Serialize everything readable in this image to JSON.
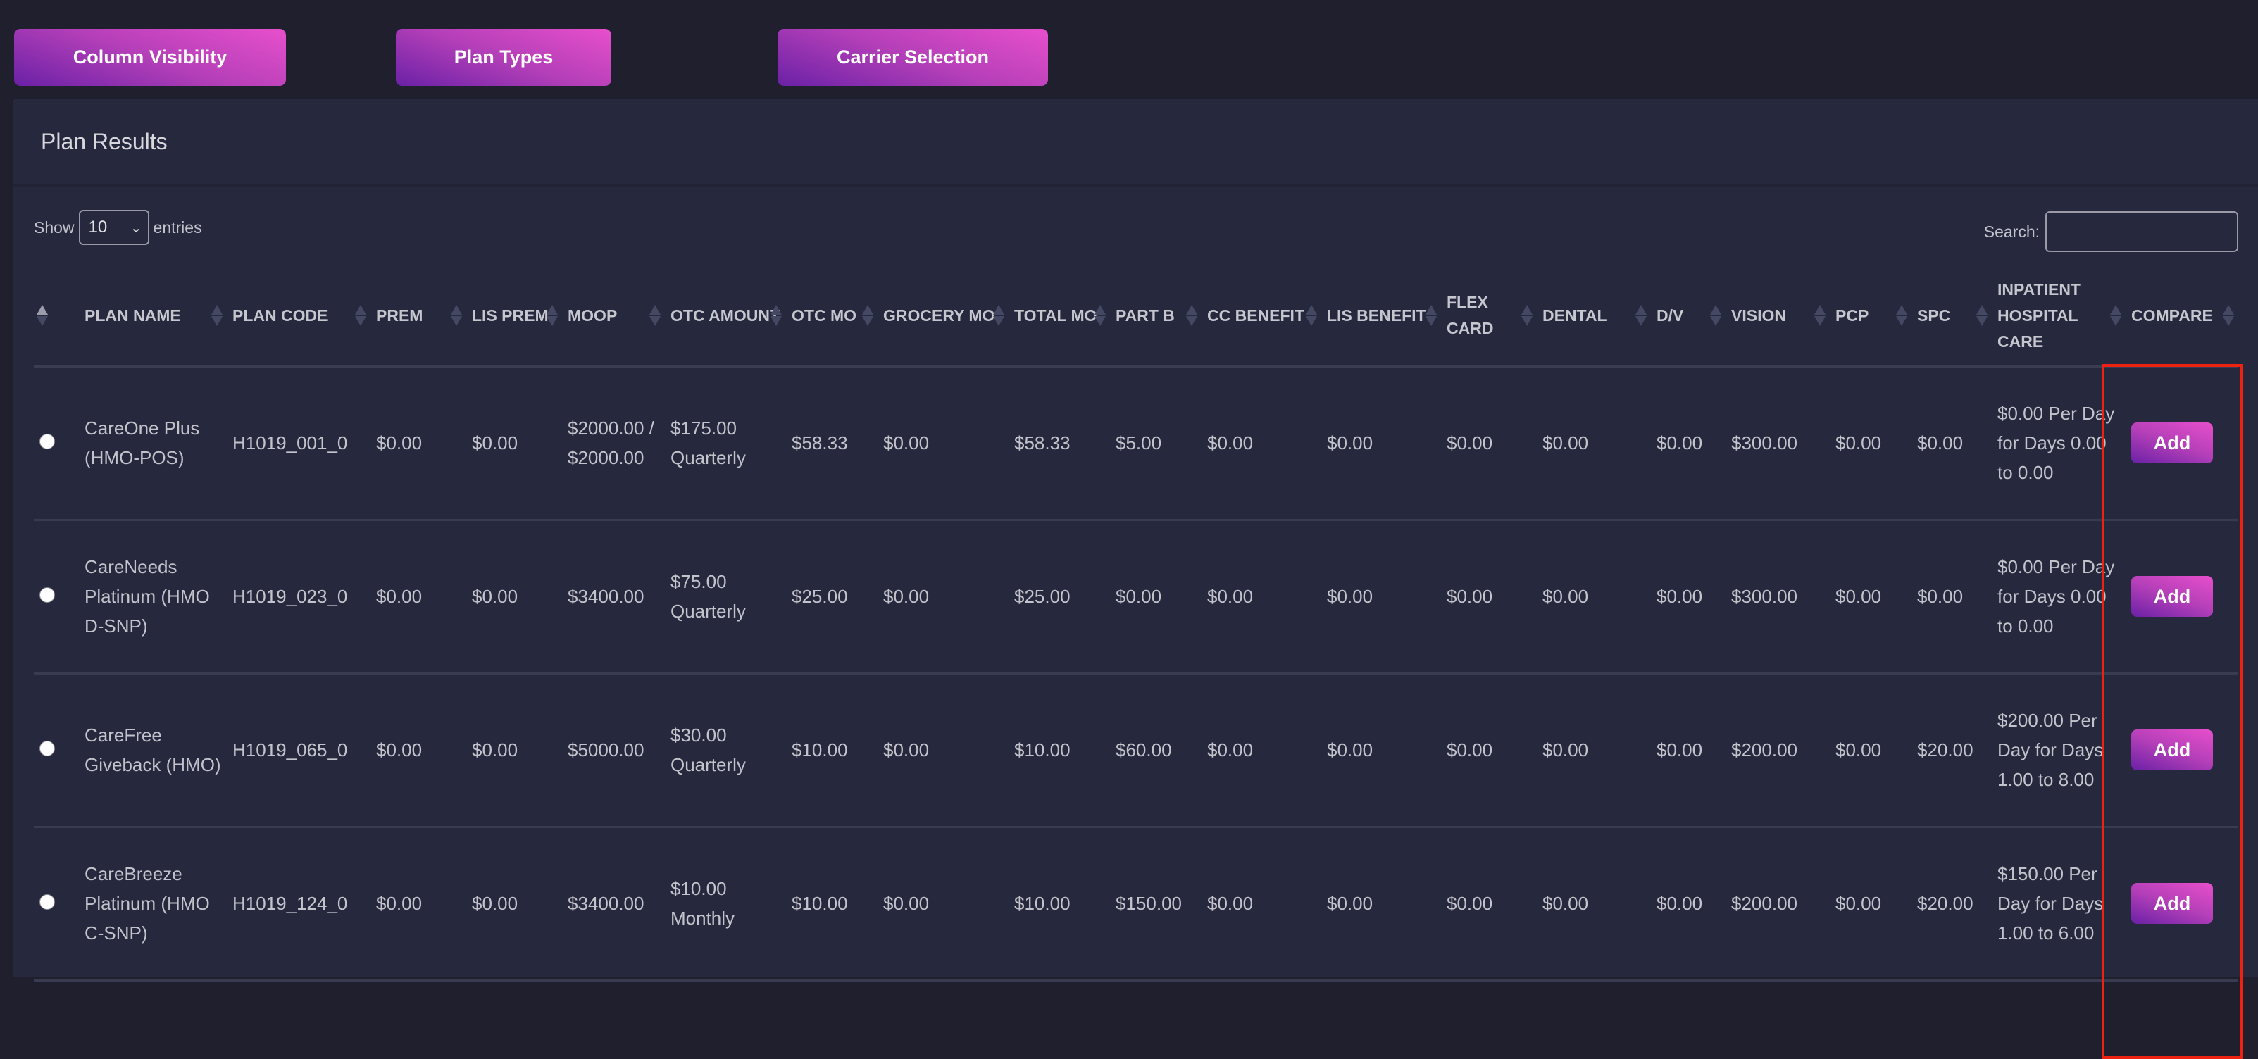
{
  "toolbar": {
    "column_visibility_label": "Column Visibility",
    "plan_types_label": "Plan Types",
    "carrier_selection_label": "Carrier Selection"
  },
  "panel": {
    "title": "Plan Results"
  },
  "length_control": {
    "prefix": "Show",
    "selected": "10",
    "suffix": "entries"
  },
  "search": {
    "label": "Search:",
    "value": "",
    "placeholder": ""
  },
  "colors": {
    "background": "#1f1f2e",
    "panel": "#26283d",
    "button_gradient_start": "#e84fcc",
    "button_gradient_end": "#6a21a6",
    "highlight_box": "#ee2211"
  },
  "table": {
    "columns": [
      {
        "key": "select",
        "label": ""
      },
      {
        "key": "plan_name",
        "label": "PLAN NAME"
      },
      {
        "key": "plan_code",
        "label": "PLAN CODE"
      },
      {
        "key": "prem",
        "label": "PREM"
      },
      {
        "key": "lis_prem",
        "label": "LIS PREM"
      },
      {
        "key": "moop",
        "label": "MOOP"
      },
      {
        "key": "otc_amount",
        "label": "OTC AMOUNT"
      },
      {
        "key": "otc_mo",
        "label": "OTC MO"
      },
      {
        "key": "grocery_mo",
        "label": "GROCERY MO"
      },
      {
        "key": "total_mo",
        "label": "TOTAL MO"
      },
      {
        "key": "part_b",
        "label": "PART B"
      },
      {
        "key": "cc_benefit",
        "label": "CC BENEFIT"
      },
      {
        "key": "lis_benefit",
        "label": "LIS BENEFIT"
      },
      {
        "key": "flex_card",
        "label": "FLEX CARD"
      },
      {
        "key": "dental",
        "label": "DENTAL"
      },
      {
        "key": "dv",
        "label": "D/V"
      },
      {
        "key": "vision",
        "label": "VISION"
      },
      {
        "key": "pcp",
        "label": "PCP"
      },
      {
        "key": "spc",
        "label": "SPC"
      },
      {
        "key": "inpatient",
        "label": "INPATIENT HOSPITAL CARE"
      },
      {
        "key": "compare",
        "label": "COMPARE"
      }
    ],
    "add_label": "Add",
    "rows": [
      {
        "plan_name": "CareOne Plus (HMO-POS)",
        "plan_code": "H1019_001_0",
        "prem": "$0.00",
        "lis_prem": "$0.00",
        "moop": "$2000.00 / $2000.00",
        "otc_amount": "$175.00 Quarterly",
        "otc_mo": "$58.33",
        "grocery_mo": "$0.00",
        "total_mo": "$58.33",
        "part_b": "$5.00",
        "cc_benefit": "$0.00",
        "lis_benefit": "$0.00",
        "flex_card": "$0.00",
        "dental": "$0.00",
        "dv": "$0.00",
        "vision": "$300.00",
        "pcp": "$0.00",
        "spc": "$0.00",
        "inpatient": "$0.00 Per Day for Days 0.00 to 0.00"
      },
      {
        "plan_name": "CareNeeds Platinum (HMO D-SNP)",
        "plan_code": "H1019_023_0",
        "prem": "$0.00",
        "lis_prem": "$0.00",
        "moop": "$3400.00",
        "otc_amount": "$75.00 Quarterly",
        "otc_mo": "$25.00",
        "grocery_mo": "$0.00",
        "total_mo": "$25.00",
        "part_b": "$0.00",
        "cc_benefit": "$0.00",
        "lis_benefit": "$0.00",
        "flex_card": "$0.00",
        "dental": "$0.00",
        "dv": "$0.00",
        "vision": "$300.00",
        "pcp": "$0.00",
        "spc": "$0.00",
        "inpatient": "$0.00 Per Day for Days 0.00 to 0.00"
      },
      {
        "plan_name": "CareFree Giveback (HMO)",
        "plan_code": "H1019_065_0",
        "prem": "$0.00",
        "lis_prem": "$0.00",
        "moop": "$5000.00",
        "otc_amount": "$30.00 Quarterly",
        "otc_mo": "$10.00",
        "grocery_mo": "$0.00",
        "total_mo": "$10.00",
        "part_b": "$60.00",
        "cc_benefit": "$0.00",
        "lis_benefit": "$0.00",
        "flex_card": "$0.00",
        "dental": "$0.00",
        "dv": "$0.00",
        "vision": "$200.00",
        "pcp": "$0.00",
        "spc": "$20.00",
        "inpatient": "$200.00 Per Day for Days 1.00 to 8.00"
      },
      {
        "plan_name": "CareBreeze Platinum (HMO C-SNP)",
        "plan_code": "H1019_124_0",
        "prem": "$0.00",
        "lis_prem": "$0.00",
        "moop": "$3400.00",
        "otc_amount": "$10.00 Monthly",
        "otc_mo": "$10.00",
        "grocery_mo": "$0.00",
        "total_mo": "$10.00",
        "part_b": "$150.00",
        "cc_benefit": "$0.00",
        "lis_benefit": "$0.00",
        "flex_card": "$0.00",
        "dental": "$0.00",
        "dv": "$0.00",
        "vision": "$200.00",
        "pcp": "$0.00",
        "spc": "$20.00",
        "inpatient": "$150.00 Per Day for Days 1.00 to 6.00"
      }
    ]
  }
}
